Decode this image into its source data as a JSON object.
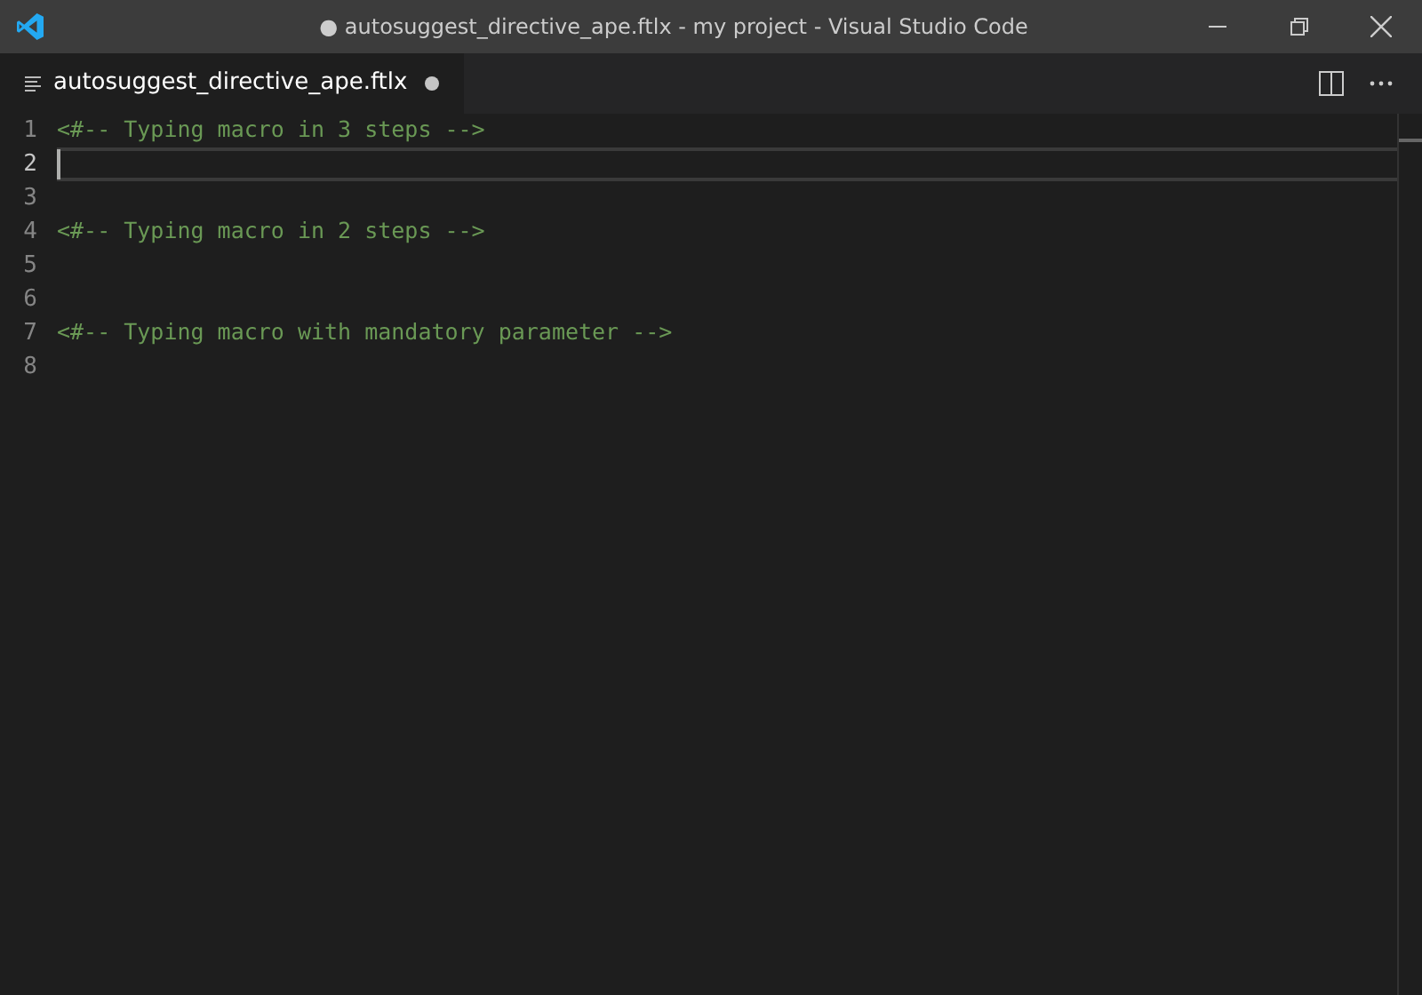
{
  "window": {
    "title": "● autosuggest_directive_ape.ftlx - my project - Visual Studio Code"
  },
  "tabs": [
    {
      "label": "autosuggest_directive_ape.ftlx",
      "selected": true,
      "modified": true
    }
  ],
  "editor": {
    "lines": [
      {
        "number": "1",
        "text": "<#-- Typing macro in 3 steps -->",
        "current": false
      },
      {
        "number": "2",
        "current": true
      },
      {
        "number": "3",
        "current": false
      },
      {
        "number": "4",
        "text": "<#-- Typing macro in 2 steps -->",
        "current": false
      },
      {
        "number": "5",
        "current": false
      },
      {
        "number": "6",
        "current": false
      },
      {
        "number": "7",
        "text": "<#-- Typing macro with mandatory parameter -->",
        "current": false
      },
      {
        "number": "8",
        "current": false
      }
    ]
  }
}
